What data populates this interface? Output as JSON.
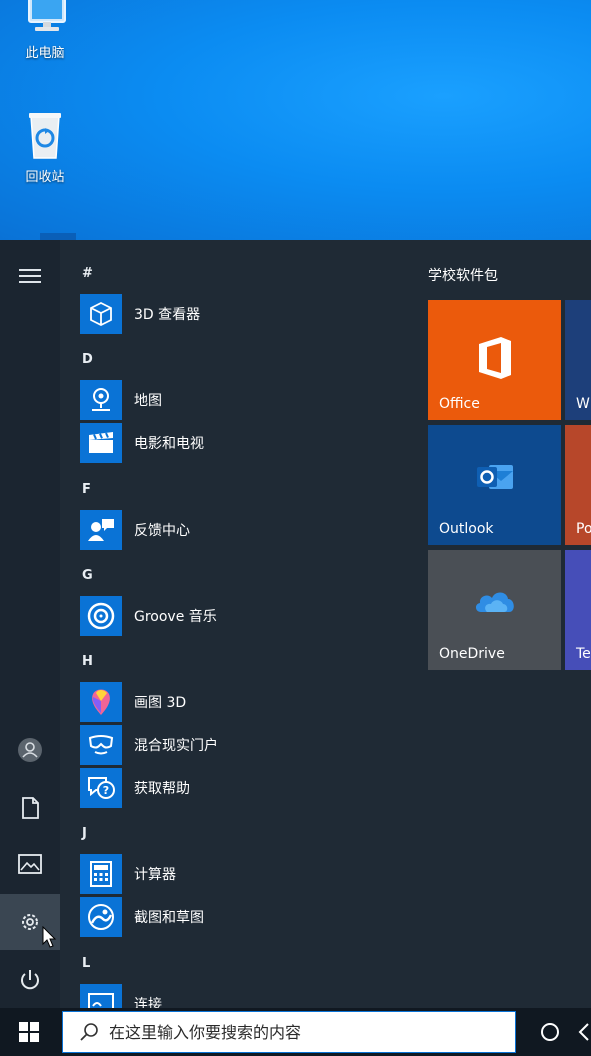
{
  "desktop": {
    "icons": [
      {
        "label": "此电脑",
        "icon": "computer-icon"
      },
      {
        "label": "回收站",
        "icon": "recycle-bin-icon"
      }
    ]
  },
  "start_menu": {
    "rail": [
      {
        "icon": "hamburger-menu-icon"
      },
      {
        "icon": "user-avatar-icon"
      },
      {
        "icon": "documents-icon"
      },
      {
        "icon": "pictures-icon"
      },
      {
        "icon": "settings-gear-icon"
      },
      {
        "icon": "power-icon"
      }
    ],
    "app_list": {
      "letters": [
        "#",
        "D",
        "F",
        "G",
        "H",
        "J",
        "L"
      ],
      "apps": [
        {
          "name": "3D 查看器",
          "icon": "3d-viewer-icon"
        },
        {
          "name": "地图",
          "icon": "maps-icon"
        },
        {
          "name": "电影和电视",
          "icon": "movies-tv-icon"
        },
        {
          "name": "反馈中心",
          "icon": "feedback-hub-icon"
        },
        {
          "name": "Groove 音乐",
          "icon": "groove-music-icon"
        },
        {
          "name": "画图 3D",
          "icon": "paint-3d-icon"
        },
        {
          "name": "混合现实门户",
          "icon": "mixed-reality-icon"
        },
        {
          "name": "获取帮助",
          "icon": "get-help-icon"
        },
        {
          "name": "计算器",
          "icon": "calculator-icon"
        },
        {
          "name": "截图和草图",
          "icon": "snip-sketch-icon"
        },
        {
          "name": "连接",
          "icon": "connect-icon"
        }
      ]
    },
    "tiles": {
      "group_title": "学校软件包",
      "items": [
        {
          "label": "Office",
          "color": "#eb5a0c",
          "icon": "office-icon"
        },
        {
          "label": "W",
          "color": "#1d3f7a",
          "icon": "word-icon"
        },
        {
          "label": "Outlook",
          "color": "#0d4a8f",
          "icon": "outlook-icon"
        },
        {
          "label": "Po",
          "color": "#b7472a",
          "icon": "powerpoint-icon"
        },
        {
          "label": "OneDrive",
          "color": "#4a4f55",
          "icon": "onedrive-icon"
        },
        {
          "label": "Te",
          "color": "#464eb8",
          "icon": "teams-icon"
        }
      ]
    }
  },
  "taskbar": {
    "search_placeholder": "在这里输入你要搜索的内容",
    "icons": [
      "windows-start-icon",
      "search-icon",
      "cortana-icon",
      "task-view-icon"
    ]
  }
}
